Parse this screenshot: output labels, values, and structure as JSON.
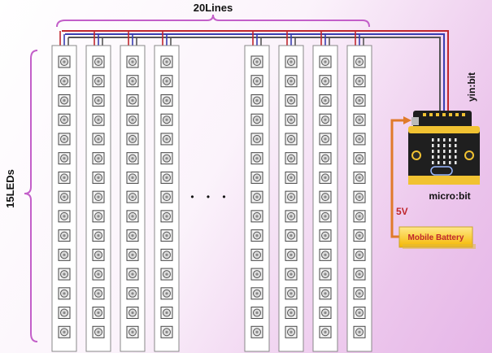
{
  "labels": {
    "lines": "20Lines",
    "leds": "15LEDs",
    "ellipsis": "• • •",
    "board_name": "micro:bit",
    "breakout_name": "yin:bit",
    "voltage": "5V",
    "battery": "Mobile Battery"
  },
  "strips": {
    "left_count": 4,
    "right_count": 4,
    "leds_per_strip": 15
  },
  "colors": {
    "brace": "#c35fc9",
    "wire_red": "#c0272d",
    "wire_blue": "#3a3fb0",
    "wire_gray": "#555555",
    "wire_orange": "#e07a2a",
    "voltage_text": "#c0272d",
    "battery_fill": "#f8c81e",
    "battery_text": "#c0272d"
  }
}
